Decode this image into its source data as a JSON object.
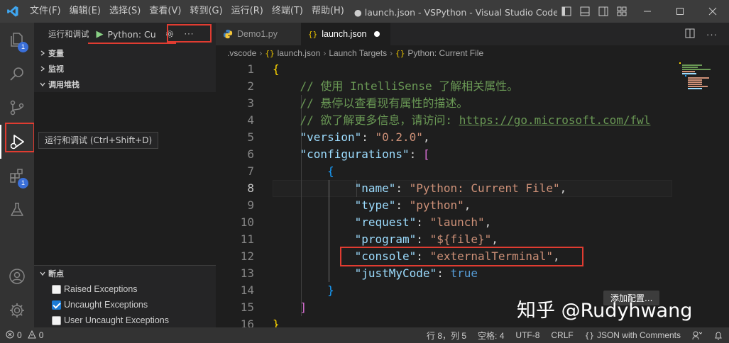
{
  "titlebar": {
    "menus": [
      "文件(F)",
      "编辑(E)",
      "选择(S)",
      "查看(V)",
      "转到(G)",
      "运行(R)",
      "终端(T)",
      "帮助(H)"
    ],
    "window_title": "● launch.json - VSPython - Visual Studio Code [管..."
  },
  "activity_bar": {
    "explorer_badge": "1",
    "extensions_badge": "1",
    "tooltip": "运行和调试 (Ctrl+Shift+D)"
  },
  "sidebar": {
    "header_title": "运行和调试",
    "config_select": "Python: Current File",
    "sections": {
      "variables": "变量",
      "watch": "监视",
      "callstack": "调用堆栈",
      "breakpoints": "断点"
    },
    "breakpoints": [
      {
        "label": "Raised Exceptions",
        "checked": false
      },
      {
        "label": "Uncaught Exceptions",
        "checked": true
      },
      {
        "label": "User Uncaught Exceptions",
        "checked": false
      }
    ]
  },
  "tabs": [
    {
      "label": "Demo1.py",
      "active": false
    },
    {
      "label": "launch.json",
      "active": true,
      "modified": true
    }
  ],
  "breadcrumb": [
    ".vscode",
    "launch.json",
    "Launch Targets",
    "Python: Current File"
  ],
  "editor": {
    "lines": [
      {
        "n": "1",
        "tokens": [
          [
            "b1",
            "{"
          ]
        ]
      },
      {
        "n": "2",
        "tokens": [
          [
            "p",
            "    "
          ],
          [
            "c",
            "// 使用 IntelliSense 了解相关属性。"
          ]
        ]
      },
      {
        "n": "3",
        "tokens": [
          [
            "p",
            "    "
          ],
          [
            "c",
            "// 悬停以查看现有属性的描述。"
          ]
        ]
      },
      {
        "n": "4",
        "tokens": [
          [
            "p",
            "    "
          ],
          [
            "c",
            "// 欲了解更多信息，请访问: "
          ],
          [
            "cu",
            "https://go.microsoft.com/fwl"
          ]
        ]
      },
      {
        "n": "5",
        "tokens": [
          [
            "p",
            "    "
          ],
          [
            "k",
            "\"version\""
          ],
          [
            "p",
            ": "
          ],
          [
            "s",
            "\"0.2.0\""
          ],
          [
            "p",
            ","
          ]
        ]
      },
      {
        "n": "6",
        "tokens": [
          [
            "p",
            "    "
          ],
          [
            "k",
            "\"configurations\""
          ],
          [
            "p",
            ": "
          ],
          [
            "b2",
            "["
          ]
        ]
      },
      {
        "n": "7",
        "tokens": [
          [
            "p",
            "        "
          ],
          [
            "b3",
            "{"
          ]
        ]
      },
      {
        "n": "8",
        "tokens": [
          [
            "p",
            "            "
          ],
          [
            "k",
            "\"name\""
          ],
          [
            "p",
            ": "
          ],
          [
            "s",
            "\"Python: Current File\""
          ],
          [
            "p",
            ","
          ]
        ]
      },
      {
        "n": "9",
        "tokens": [
          [
            "p",
            "            "
          ],
          [
            "k",
            "\"type\""
          ],
          [
            "p",
            ": "
          ],
          [
            "s",
            "\"python\""
          ],
          [
            "p",
            ","
          ]
        ]
      },
      {
        "n": "10",
        "tokens": [
          [
            "p",
            "            "
          ],
          [
            "k",
            "\"request\""
          ],
          [
            "p",
            ": "
          ],
          [
            "s",
            "\"launch\""
          ],
          [
            "p",
            ","
          ]
        ]
      },
      {
        "n": "11",
        "tokens": [
          [
            "p",
            "            "
          ],
          [
            "k",
            "\"program\""
          ],
          [
            "p",
            ": "
          ],
          [
            "s",
            "\"${file}\""
          ],
          [
            "p",
            ","
          ]
        ]
      },
      {
        "n": "12",
        "tokens": [
          [
            "p",
            "            "
          ],
          [
            "k",
            "\"console\""
          ],
          [
            "p",
            ": "
          ],
          [
            "s",
            "\"externalTerminal\""
          ],
          [
            "p",
            ","
          ]
        ]
      },
      {
        "n": "13",
        "tokens": [
          [
            "p",
            "            "
          ],
          [
            "k",
            "\"justMyCode\""
          ],
          [
            "p",
            ": "
          ],
          [
            "kw",
            "true"
          ]
        ]
      },
      {
        "n": "14",
        "tokens": [
          [
            "p",
            "        "
          ],
          [
            "b3",
            "}"
          ]
        ]
      },
      {
        "n": "15",
        "tokens": [
          [
            "p",
            "    "
          ],
          [
            "b2",
            "]"
          ]
        ]
      },
      {
        "n": "16",
        "tokens": [
          [
            "b1",
            "}"
          ]
        ]
      }
    ],
    "current_line": "8",
    "add_config_button": "添加配置..."
  },
  "watermark": "知乎 @Rudyhwang",
  "statusbar": {
    "errors": "0",
    "warnings": "0",
    "cursor": "行 8，列 5",
    "spaces": "空格: 4",
    "encoding": "UTF-8",
    "eol": "CRLF",
    "language": "JSON with Comments"
  },
  "colors": {
    "highlight_box": "#e03c31",
    "string": "#ce9178",
    "key": "#9cdcfe",
    "comment": "#6a9955"
  }
}
